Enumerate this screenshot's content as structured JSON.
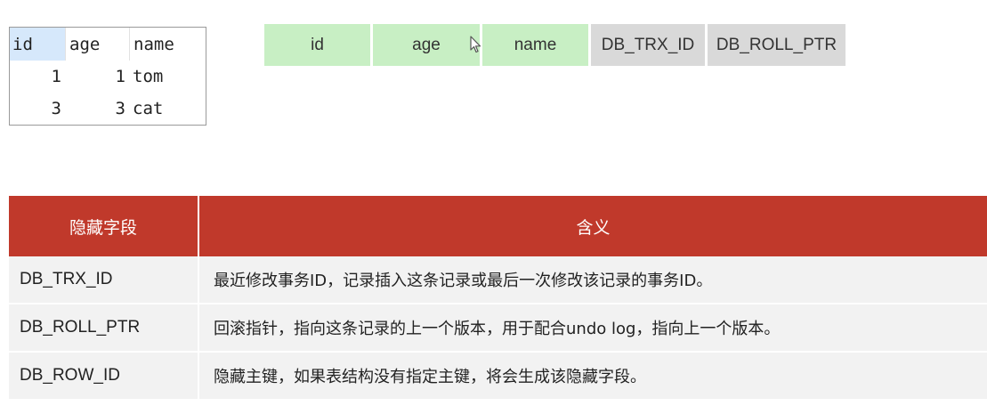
{
  "result_grid": {
    "headers": [
      "id",
      "age",
      "name"
    ],
    "rows": [
      [
        "1",
        "1",
        "tom"
      ],
      [
        "3",
        "3",
        "cat"
      ]
    ]
  },
  "row_format": {
    "columns": [
      {
        "label": "id",
        "color": "#c8efc4"
      },
      {
        "label": "age",
        "color": "#c8efc4"
      },
      {
        "label": "name",
        "color": "#c8efc4"
      },
      {
        "label": "DB_TRX_ID",
        "color": "#d9d9d9"
      },
      {
        "label": "DB_ROLL_PTR",
        "color": "#d9d9d9"
      }
    ]
  },
  "hidden_fields_table": {
    "header": {
      "field": "隐藏字段",
      "meaning": "含义"
    },
    "header_color": "#c0392b",
    "rows": [
      {
        "field": "DB_TRX_ID",
        "meaning": "最近修改事务ID，记录插入这条记录或最后一次修改该记录的事务ID。"
      },
      {
        "field": "DB_ROLL_PTR",
        "meaning": "回滚指针，指向这条记录的上一个版本，用于配合undo log，指向上一个版本。"
      },
      {
        "field": "DB_ROW_ID",
        "meaning": "隐藏主键，如果表结构没有指定主键，将会生成该隐藏字段。"
      }
    ]
  },
  "cursor_icon": "mouse-pointer-icon"
}
